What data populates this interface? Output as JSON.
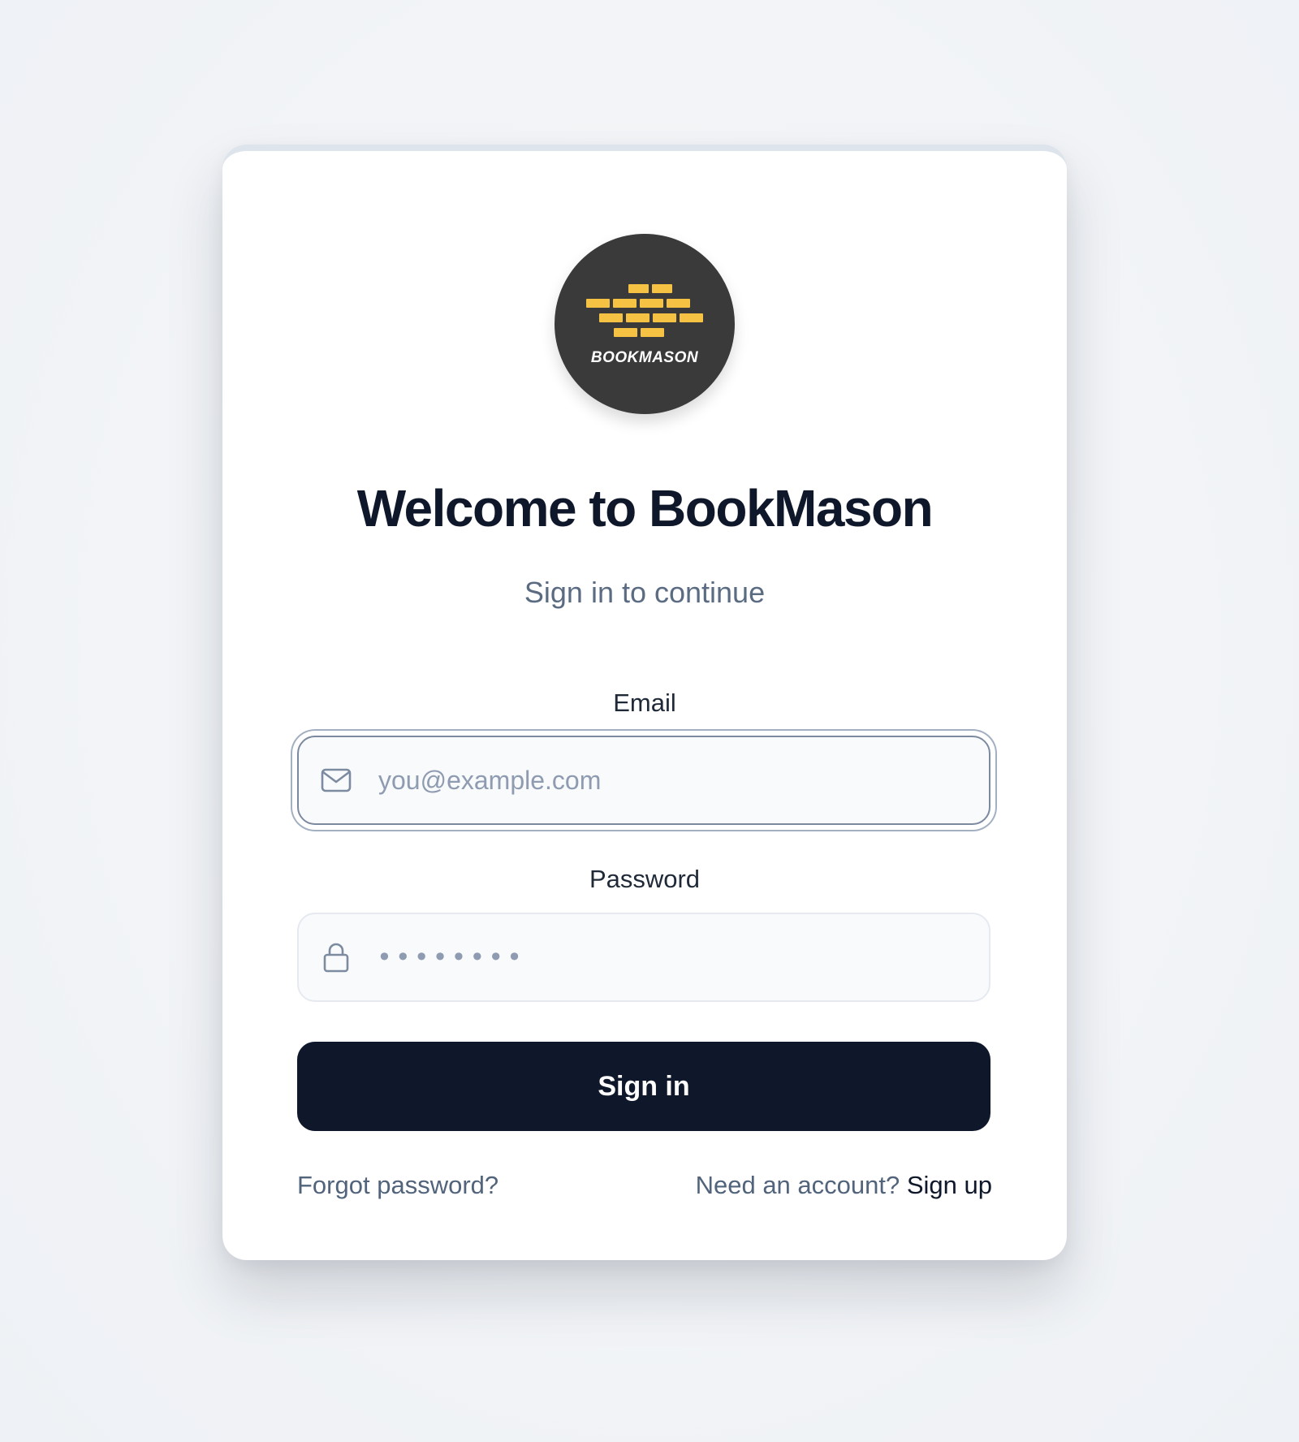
{
  "brand": {
    "logo_text": "BOOKMASON",
    "colors": {
      "logo_bg": "#3a3a3a",
      "brick": "#f6c244",
      "primary": "#0f172a",
      "muted": "#5b6b82"
    }
  },
  "header": {
    "title": "Welcome to BookMason",
    "subtitle": "Sign in to continue"
  },
  "form": {
    "email": {
      "label": "Email",
      "placeholder": "you@example.com",
      "value": "",
      "icon": "mail-icon"
    },
    "password": {
      "label": "Password",
      "placeholder": "••••••••",
      "value": "",
      "icon": "lock-icon"
    },
    "submit_label": "Sign in"
  },
  "footer": {
    "forgot_label": "Forgot password?",
    "signup_prompt": "Need an account?",
    "signup_label": "Sign up"
  }
}
